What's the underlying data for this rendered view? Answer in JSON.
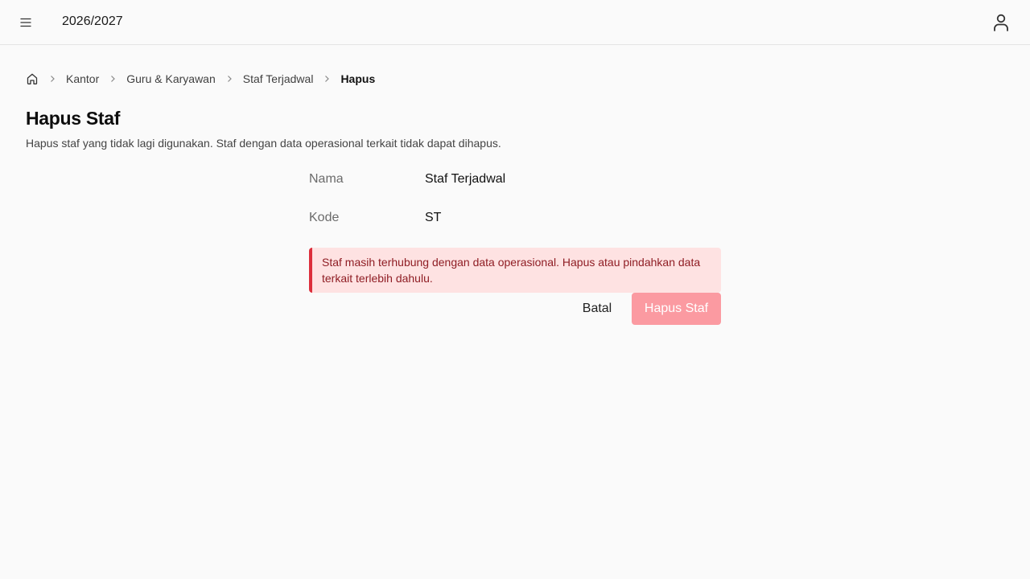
{
  "header": {
    "menu_icon": "hamburger-menu-icon",
    "academic_year": "2026/2027",
    "user_icon": "user-icon"
  },
  "breadcrumb": {
    "home_icon": "home-icon",
    "separator_icon": "chevron-right-icon",
    "items": [
      {
        "label": "Kantor"
      },
      {
        "label": "Guru & Karyawan"
      },
      {
        "label": "Staf Terjadwal"
      }
    ],
    "current": "Hapus"
  },
  "page": {
    "title": "Hapus Staf",
    "description": "Hapus staf yang tidak lagi digunakan. Staf dengan data operasional terkait tidak dapat dihapus."
  },
  "details": [
    {
      "label": "Nama",
      "value": "Staf Terjadwal"
    },
    {
      "label": "Kode",
      "value": "ST"
    }
  ],
  "alert": {
    "message": "Staf masih terhubung dengan data operasional. Hapus atau pindahkan data terkait terlebih dahulu.",
    "color": "#dc2f3c"
  },
  "actions": {
    "cancel_label": "Batal",
    "delete_label": "Hapus Staf",
    "delete_enabled": false
  },
  "colors": {
    "danger": "#dc2f3c",
    "danger_disabled": "#fb9aa1",
    "alert_bg": "#fee2e2",
    "background": "#fafafa"
  }
}
